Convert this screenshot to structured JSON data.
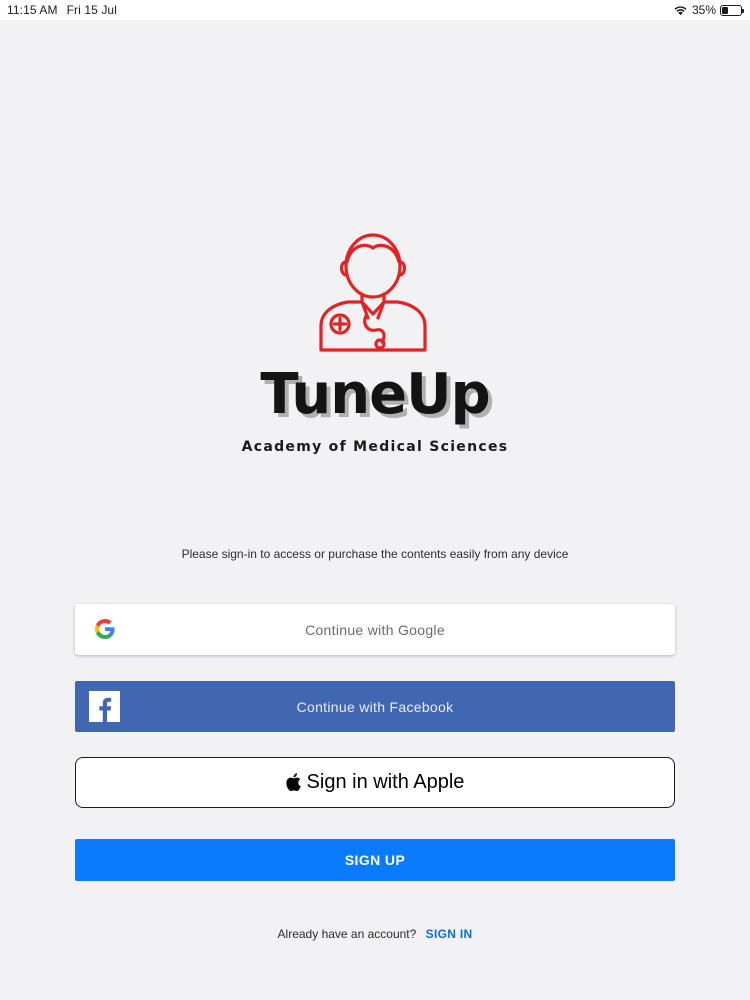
{
  "status_bar": {
    "time": "11:15 AM",
    "date": "Fri 15 Jul",
    "battery_percent": "35%",
    "battery_level": 0.35
  },
  "brand": {
    "title": "TuneUp",
    "subtitle": "Academy of Medical Sciences",
    "logo_icon": "doctor-stethoscope-icon",
    "logo_color": "#e02424"
  },
  "intro_text": "Please sign-in to access or purchase the contents easily from any device",
  "buttons": {
    "google_label": "Continue with Google",
    "facebook_label": "Continue with Facebook",
    "apple_label": "Sign in with Apple",
    "signup_label": "SIGN UP"
  },
  "footer": {
    "prompt": "Already have an account?",
    "signin_label": "SIGN IN"
  },
  "colors": {
    "background": "#f2f2f4",
    "facebook": "#4267b2",
    "primary": "#0a7aff",
    "link": "#0a6ddc"
  }
}
